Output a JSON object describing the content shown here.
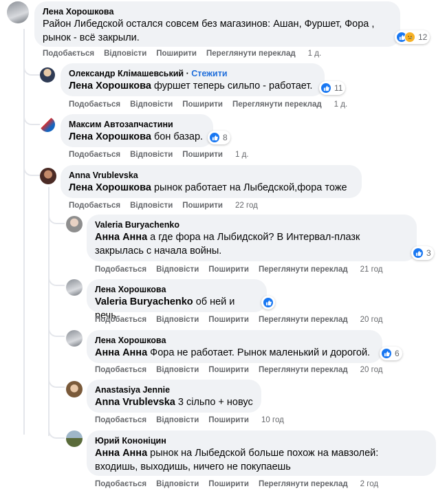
{
  "comments": [
    {
      "author": "Лена Хорошкова",
      "text": "Район Либедской остался совсем без магазинов: Ашан, Фуршет, Фора , рынок - всё закрыли.",
      "text_lines": [
        "Район Либедской остался совсем без магазинов: Ашан, Фуршет, Фора ,",
        "рынок - всё закрыли."
      ],
      "actions": [
        "Подобається",
        "Відповісти",
        "Поширити",
        "Переглянути переклад"
      ],
      "time": "1 д.",
      "reactions": {
        "count": "12",
        "types": [
          "like-icon",
          "sad-icon"
        ]
      }
    },
    {
      "author": "Олександр Клімашевський",
      "follow": "Стежити",
      "mention": "Лена Хорошкова",
      "text": "фуршет теперь сильпо - работает.",
      "actions": [
        "Подобається",
        "Відповісти",
        "Поширити",
        "Переглянути переклад"
      ],
      "time": "1 д.",
      "reactions": {
        "count": "11",
        "types": [
          "like-icon"
        ]
      }
    },
    {
      "author": "Максим Автозапчастини",
      "mention": "Лена Хорошкова",
      "text": "бон базар.",
      "actions": [
        "Подобається",
        "Відповісти",
        "Поширити"
      ],
      "time": "1 д.",
      "reactions": {
        "count": "8",
        "types": [
          "like-icon"
        ]
      }
    },
    {
      "author": "Anna Vrublevska",
      "mention": "Лена Хорошкова",
      "text": "рынок работает на Лыбедской,фора тоже",
      "actions": [
        "Подобається",
        "Відповісти",
        "Поширити"
      ],
      "time": "22 год"
    },
    {
      "author": "Valeria Buryachenko",
      "mention": "Анна Анна",
      "text": "а где фора на Лыбидской? В Интервал-плазк закрылась с начала войны.",
      "text_lines": [
        "а где фора на Лыбидской? В Интервал-плазк",
        "закрылась с начала войны."
      ],
      "actions": [
        "Подобається",
        "Відповісти",
        "Поширити",
        "Переглянути переклад"
      ],
      "time": "21 год",
      "reactions": {
        "count": "3",
        "types": [
          "like-icon"
        ]
      }
    },
    {
      "author": "Лена Хорошкова",
      "mention": "Valeria Buryachenko",
      "text": "об ней и речь",
      "actions": [
        "Подобається",
        "Відповісти",
        "Поширити",
        "Переглянути переклад"
      ],
      "time": "20 год",
      "reactions": {
        "count": "",
        "types": [
          "like-icon"
        ]
      }
    },
    {
      "author": "Лена Хорошкова",
      "mention": "Анна Анна",
      "text": "Фора не работает. Рынок маленький и дорогой.",
      "actions": [
        "Подобається",
        "Відповісти",
        "Поширити",
        "Переглянути переклад"
      ],
      "time": "20 год",
      "reactions": {
        "count": "6",
        "types": [
          "like-icon"
        ]
      }
    },
    {
      "author": "Anastasiya Jennie",
      "mention": "Anna Vrublevska",
      "text": "3 сільпо + новус",
      "actions": [
        "Подобається",
        "Відповісти",
        "Поширити"
      ],
      "time": "10 год"
    },
    {
      "author": "Юрий Кононіцин",
      "mention": "Анна Анна",
      "text": "рынок на Лыбедской больше похож на мавзолей: входишь, выходишь, ничего не покупаешь",
      "text_lines": [
        "рынок на Лыбедской больше похож на мавзолей:",
        "входишь, выходишь, ничего не покупаешь"
      ],
      "actions": [
        "Подобається",
        "Відповісти",
        "Поширити",
        "Переглянути переклад"
      ],
      "time": "2 год"
    }
  ],
  "colors": {
    "bubble": "#f0f2f5",
    "like": "#1877f2",
    "follow": "#216fdb",
    "meta": "#65676b"
  }
}
